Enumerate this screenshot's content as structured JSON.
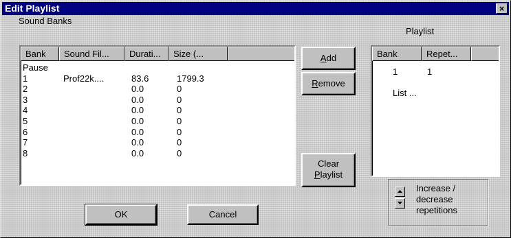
{
  "window": {
    "title": "Edit Playlist",
    "close_glyph": "×"
  },
  "sound_banks": {
    "label": "Sound Banks",
    "columns": [
      "Bank",
      "Sound Fil...",
      "Durati...",
      "Size (..."
    ],
    "rows": [
      {
        "bank": "Pause",
        "file": "",
        "duration": "",
        "size": ""
      },
      {
        "bank": "1",
        "file": "Prof22k....",
        "duration": "83.6",
        "size": "1799.3"
      },
      {
        "bank": "2",
        "file": "",
        "duration": "0.0",
        "size": "0"
      },
      {
        "bank": "3",
        "file": "",
        "duration": "0.0",
        "size": "0"
      },
      {
        "bank": "4",
        "file": "",
        "duration": "0.0",
        "size": "0"
      },
      {
        "bank": "5",
        "file": "",
        "duration": "0.0",
        "size": "0"
      },
      {
        "bank": "6",
        "file": "",
        "duration": "0.0",
        "size": "0"
      },
      {
        "bank": "7",
        "file": "",
        "duration": "0.0",
        "size": "0"
      },
      {
        "bank": "8",
        "file": "",
        "duration": "0.0",
        "size": "0"
      }
    ]
  },
  "actions": {
    "add": {
      "label": "Add",
      "accel": "A",
      "rest": "dd"
    },
    "remove": {
      "label": "Remove",
      "accel": "R",
      "rest": "emove"
    },
    "clear": {
      "line1": "Clear",
      "line2": "Playlist",
      "accel": "P",
      "rest": "laylist"
    }
  },
  "playlist": {
    "label": "Playlist",
    "columns": [
      "Bank",
      "Repet..."
    ],
    "rows": [
      {
        "bank": "1",
        "repetitions": "1"
      },
      {
        "bank": "List ...",
        "repetitions": ""
      }
    ]
  },
  "repetitions": {
    "label_line1": "Increase /",
    "label_line2": "decrease",
    "label_line3": "repetitions",
    "up_icon": "arrow-up",
    "down_icon": "arrow-down"
  },
  "footer": {
    "ok_label": "OK",
    "cancel_label": "Cancel"
  }
}
